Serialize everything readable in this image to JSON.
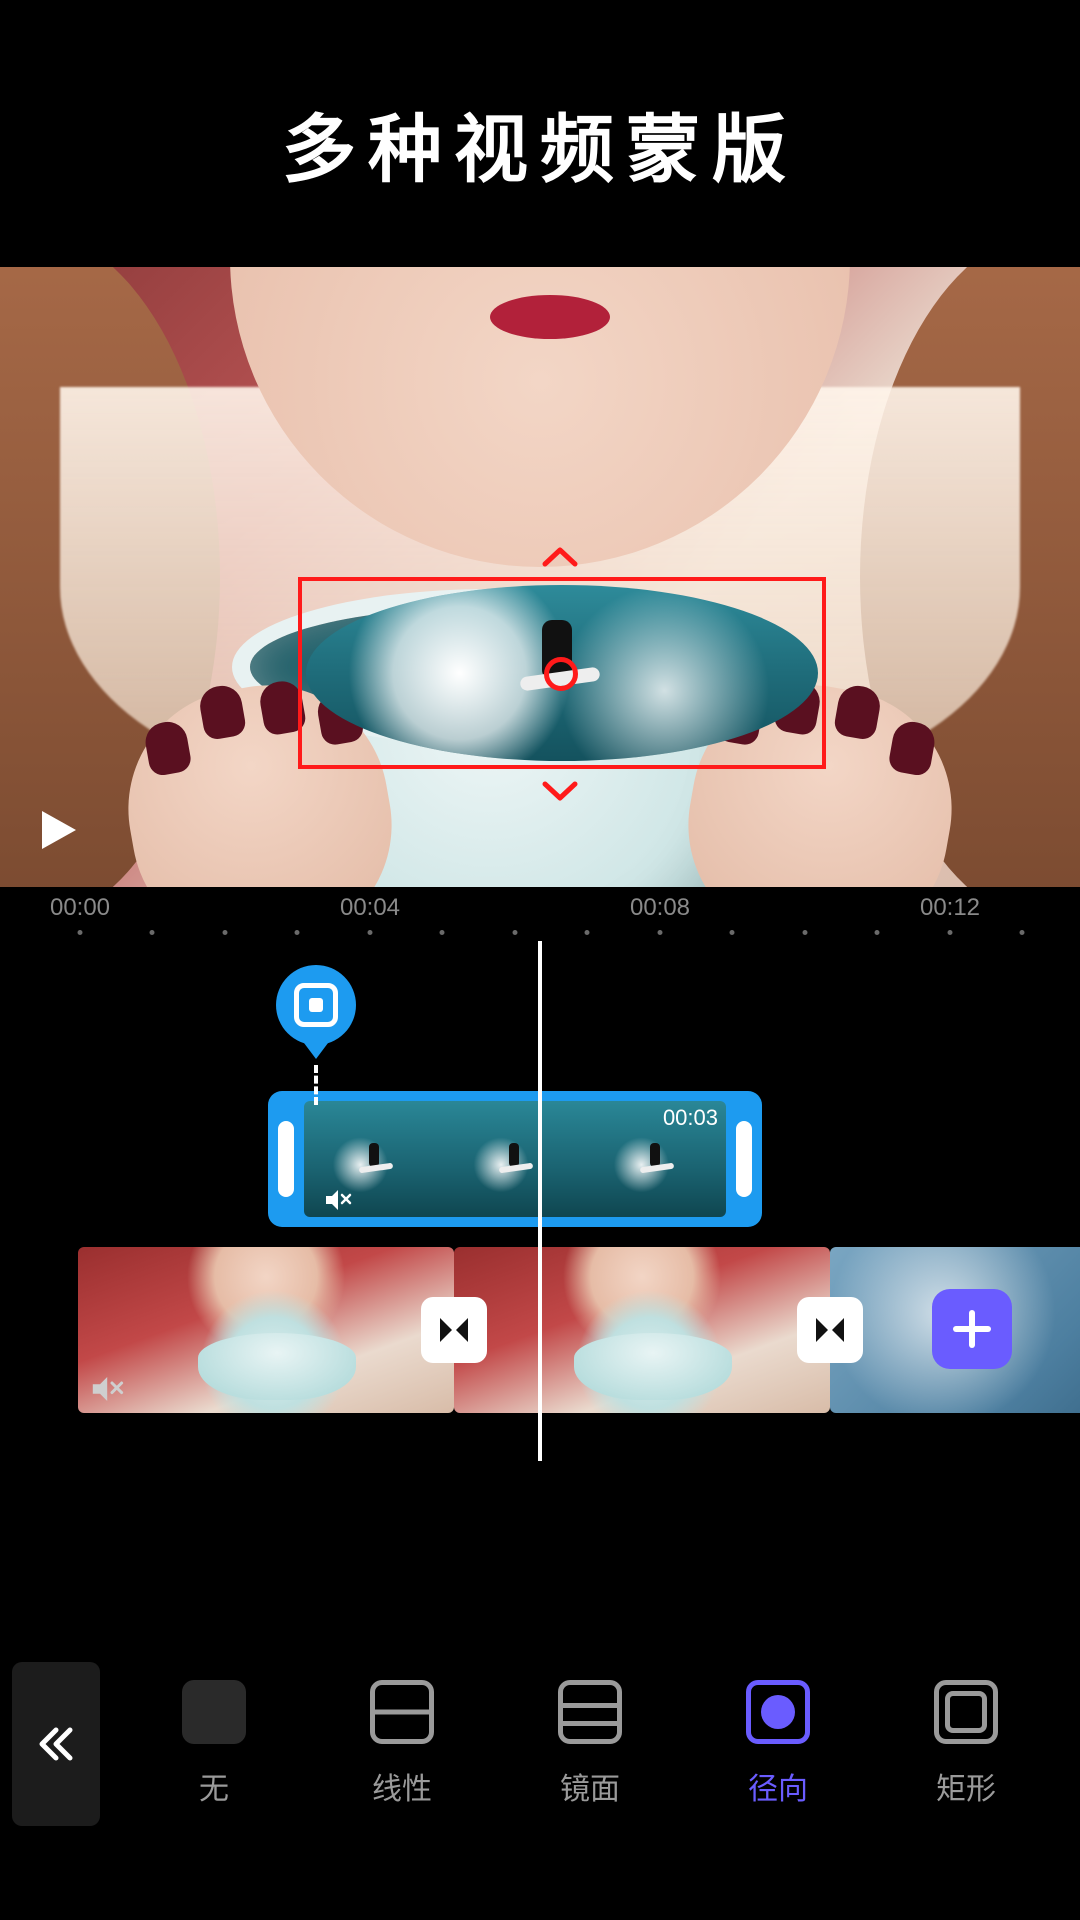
{
  "header": {
    "title": "多种视频蒙版"
  },
  "timeline": {
    "ruler_labels": [
      "00:00",
      "00:04",
      "00:08",
      "00:12"
    ],
    "overlay_clip": {
      "duration": "00:03"
    }
  },
  "mask_options": [
    {
      "key": "none",
      "label": "无",
      "active": false
    },
    {
      "key": "linear",
      "label": "线性",
      "active": false
    },
    {
      "key": "mirror",
      "label": "镜面",
      "active": false
    },
    {
      "key": "radial",
      "label": "径向",
      "active": true
    },
    {
      "key": "rect",
      "label": "矩形",
      "active": false
    }
  ],
  "icons": {
    "play": "play-icon",
    "mute": "mute-icon",
    "transition": "transition-icon",
    "add": "plus-icon",
    "collapse": "chevron-double-left-icon",
    "keyframe": "keyframe-icon",
    "handle_up": "chevron-up-icon",
    "handle_down": "chevron-down-icon"
  }
}
